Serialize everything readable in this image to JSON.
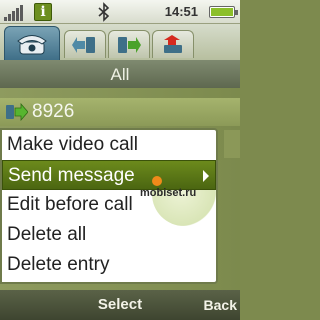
{
  "status_bar": {
    "time": "14:51",
    "icons": [
      "signal-icon",
      "info-icon",
      "bluetooth-icon",
      "battery-icon"
    ]
  },
  "tabs": [
    {
      "name": "phone-tab",
      "icon": "phone-icon",
      "active": true
    },
    {
      "name": "incoming-calls-tab",
      "icon": "incoming-arrow-icon",
      "active": false
    },
    {
      "name": "outgoing-calls-tab",
      "icon": "outgoing-arrow-icon",
      "active": false
    },
    {
      "name": "missed-calls-tab",
      "icon": "missed-call-icon",
      "active": false
    }
  ],
  "header": {
    "title": "All"
  },
  "list": {
    "items": [
      {
        "label": "8926",
        "icon": "outgoing-call-icon"
      }
    ]
  },
  "menu": {
    "items": [
      {
        "label": "Make video call",
        "selected": false
      },
      {
        "label": "Send message",
        "selected": true
      },
      {
        "label": "Edit before call",
        "selected": false
      },
      {
        "label": "Delete all",
        "selected": false
      },
      {
        "label": "Delete entry",
        "selected": false
      }
    ]
  },
  "watermark": "mobiset.ru",
  "softkeys": {
    "select": "Select",
    "back": "Back"
  },
  "colors": {
    "accent": "#5a7a14",
    "menu_background": "#ffffff",
    "list_background": "#8a975a",
    "header_background": "#6b7658"
  }
}
